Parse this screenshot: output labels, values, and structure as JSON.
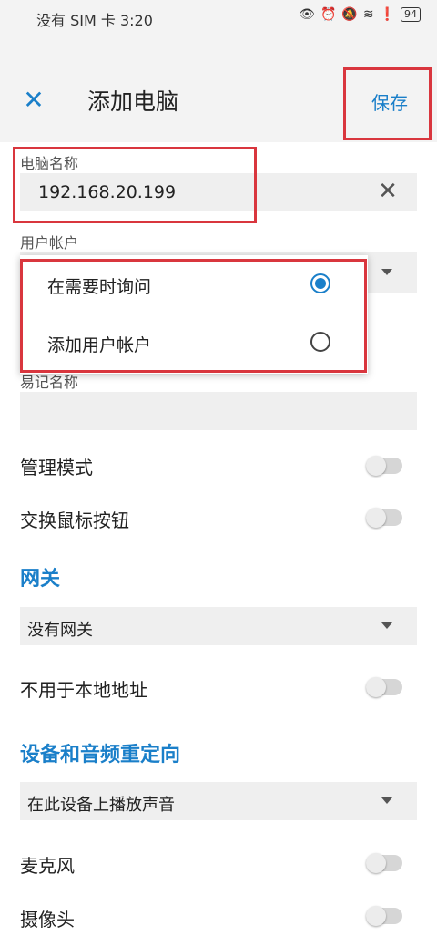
{
  "status_bar": {
    "carrier_time": "没有 SIM 卡 3:20",
    "battery": "94"
  },
  "app_bar": {
    "title": "添加电脑",
    "save_label": "保存"
  },
  "pc_name": {
    "label": "电脑名称",
    "value": "192.168.20.199"
  },
  "user_account": {
    "label": "用户帐户",
    "options": [
      {
        "label": "在需要时询问",
        "selected": true
      },
      {
        "label": "添加用户帐户",
        "selected": false
      }
    ]
  },
  "friendly_name": {
    "label": "易记名称",
    "value": ""
  },
  "switches": {
    "admin_mode": "管理模式",
    "swap_mouse": "交换鼠标按钮",
    "bypass_local": "不用于本地地址",
    "microphone": "麦克风",
    "camera": "摄像头"
  },
  "gateway": {
    "section": "网关",
    "value": "没有网关"
  },
  "redirect": {
    "section": "设备和音频重定向",
    "sound_value": "在此设备上播放声音"
  },
  "colors": {
    "accent": "#1a7fc9",
    "highlight": "#d9363e"
  }
}
